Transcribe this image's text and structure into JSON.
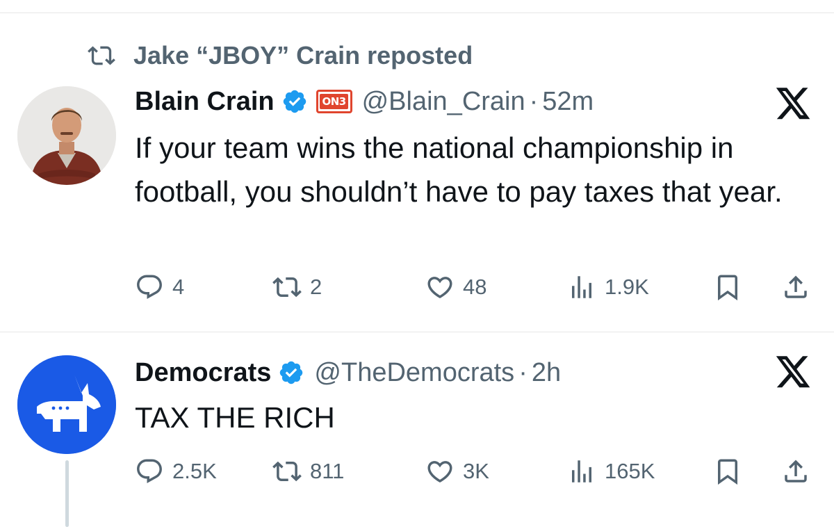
{
  "repost": {
    "label": "Jake “JBOY” Crain reposted",
    "icon": "repost-icon"
  },
  "tweets": [
    {
      "author": "Blain Crain",
      "verified": true,
      "affiliate_badge": "ON3",
      "handle": "@Blain_Crain",
      "separator": "·",
      "time": "52m",
      "text": "If your team wins the national championship in football, you shouldn’t have to pay taxes that year.",
      "stats": {
        "replies": "4",
        "reposts": "2",
        "likes": "48",
        "views": "1.9K"
      }
    },
    {
      "author": "Democrats",
      "verified": true,
      "handle": "@TheDemocrats",
      "separator": "·",
      "time": "2h",
      "text": "TAX THE RICH",
      "stats": {
        "replies": "2.5K",
        "reposts": "811",
        "likes": "3K",
        "views": "165K"
      }
    }
  ],
  "colors": {
    "text_primary": "#0f1419",
    "text_secondary": "#536471",
    "verified_blue": "#1d9bf0",
    "democrats_blue": "#1a5ae6",
    "on3_red": "#e0452e"
  }
}
